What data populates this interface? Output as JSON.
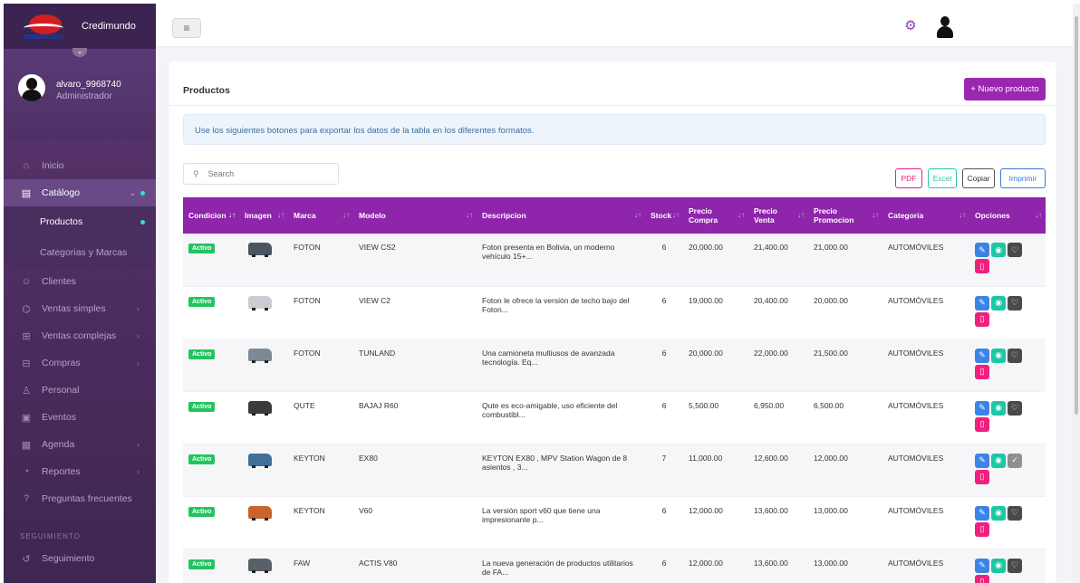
{
  "app": {
    "brand_name": "Credimundo",
    "logo_text": "CREDIMUNDO"
  },
  "user": {
    "name": "alvaro_9968740",
    "role": "Administrador"
  },
  "sidebar": {
    "items": [
      {
        "label": "Inicio",
        "icon": "home-icon"
      },
      {
        "label": "Catálogo",
        "icon": "catalog-icon",
        "active": true
      },
      {
        "label": "Clientes",
        "icon": "users-icon"
      },
      {
        "label": "Ventas simples",
        "icon": "cart-icon"
      },
      {
        "label": "Ventas complejas",
        "icon": "cart-plus-icon"
      },
      {
        "label": "Compras",
        "icon": "shopping-icon"
      },
      {
        "label": "Personal",
        "icon": "person-icon"
      },
      {
        "label": "Eventos",
        "icon": "event-icon"
      },
      {
        "label": "Agenda",
        "icon": "calendar-icon"
      },
      {
        "label": "Reportes",
        "icon": "report-icon"
      },
      {
        "label": "Preguntas frecuentes",
        "icon": "question-icon"
      }
    ],
    "submenu": [
      {
        "label": "Productos"
      },
      {
        "label": "Categorias y Marcas"
      }
    ],
    "section_label": "SEGUIMIENTO",
    "tracking_item": {
      "label": "Seguimiento",
      "icon": "history-icon"
    }
  },
  "page": {
    "title": "Productos",
    "new_button": "+ Nuevo producto",
    "alert": "Use los siguientes botones para exportar los datos de la tabla en los diferentes formatos.",
    "search_placeholder": "Search",
    "export": {
      "pdf": "PDF",
      "excel": "Excel",
      "copy": "Copiar",
      "print": "Imprimir"
    }
  },
  "table": {
    "headers": [
      "Condicion",
      "Imagen",
      "Marca",
      "Modelo",
      "Descripcion",
      "Stock",
      "Precio Compra",
      "Precio Venta",
      "Precio Promocion",
      "Categoria",
      "Opciones"
    ],
    "rows": [
      {
        "status": "Activo",
        "car_color": "#4a5560",
        "brand": "FOTON",
        "model": "VIEW CS2",
        "description": "Foton presenta en Bolivia, un moderno vehículo 15+...",
        "stock": "6",
        "buy": "20,000.00",
        "sell": "21,400.00",
        "promo": "21,000.00",
        "category": "AUTOMÓVILES",
        "check": false
      },
      {
        "status": "Activo",
        "car_color": "#c9ccd0",
        "brand": "FOTON",
        "model": "VIEW C2",
        "description": "Foton le ofrece la versión de techo bajo del Foton...",
        "stock": "6",
        "buy": "19,000.00",
        "sell": "20,400.00",
        "promo": "20,000.00",
        "category": "AUTOMÓVILES",
        "check": false
      },
      {
        "status": "Activo",
        "car_color": "#7d8a96",
        "brand": "FOTON",
        "model": "TUNLAND",
        "description": "Una camioneta multiusos de avanzada tecnología. Eq...",
        "stock": "6",
        "buy": "20,000.00",
        "sell": "22,000.00",
        "promo": "21,500.00",
        "category": "AUTOMÓVILES",
        "check": false
      },
      {
        "status": "Activo",
        "car_color": "#3c3c3c",
        "brand": "QUTE",
        "model": "BAJAJ R60",
        "description": "Qute es eco-amigable, uso eficiente del combustibl...",
        "stock": "6",
        "buy": "5,500.00",
        "sell": "6,950.00",
        "promo": "6,500.00",
        "category": "AUTOMÓVILES",
        "check": false
      },
      {
        "status": "Activo",
        "car_color": "#3f6f9a",
        "brand": "KEYTON",
        "model": "EX80",
        "description": "KEYTON EX80 , MPV Station Wagon de 8 asientos , 3...",
        "stock": "7",
        "buy": "11,000.00",
        "sell": "12,600.00",
        "promo": "12,000.00",
        "category": "AUTOMÓVILES",
        "check": true
      },
      {
        "status": "Activo",
        "car_color": "#c8642c",
        "brand": "KEYTON",
        "model": "V60",
        "description": "La versión sport v60 que tiene una impresionante p...",
        "stock": "6",
        "buy": "12,000.00",
        "sell": "13,600.00",
        "promo": "13,000.00",
        "category": "AUTOMÓVILES",
        "check": false
      },
      {
        "status": "Activo",
        "car_color": "#5a6068",
        "brand": "FAW",
        "model": "ACTIS V80",
        "description": "La nueva generación de productos utilitarios de FA...",
        "stock": "6",
        "buy": "12,000.00",
        "sell": "13,600.00",
        "promo": "13,000.00",
        "category": "AUTOMÓVILES",
        "check": false
      }
    ]
  }
}
